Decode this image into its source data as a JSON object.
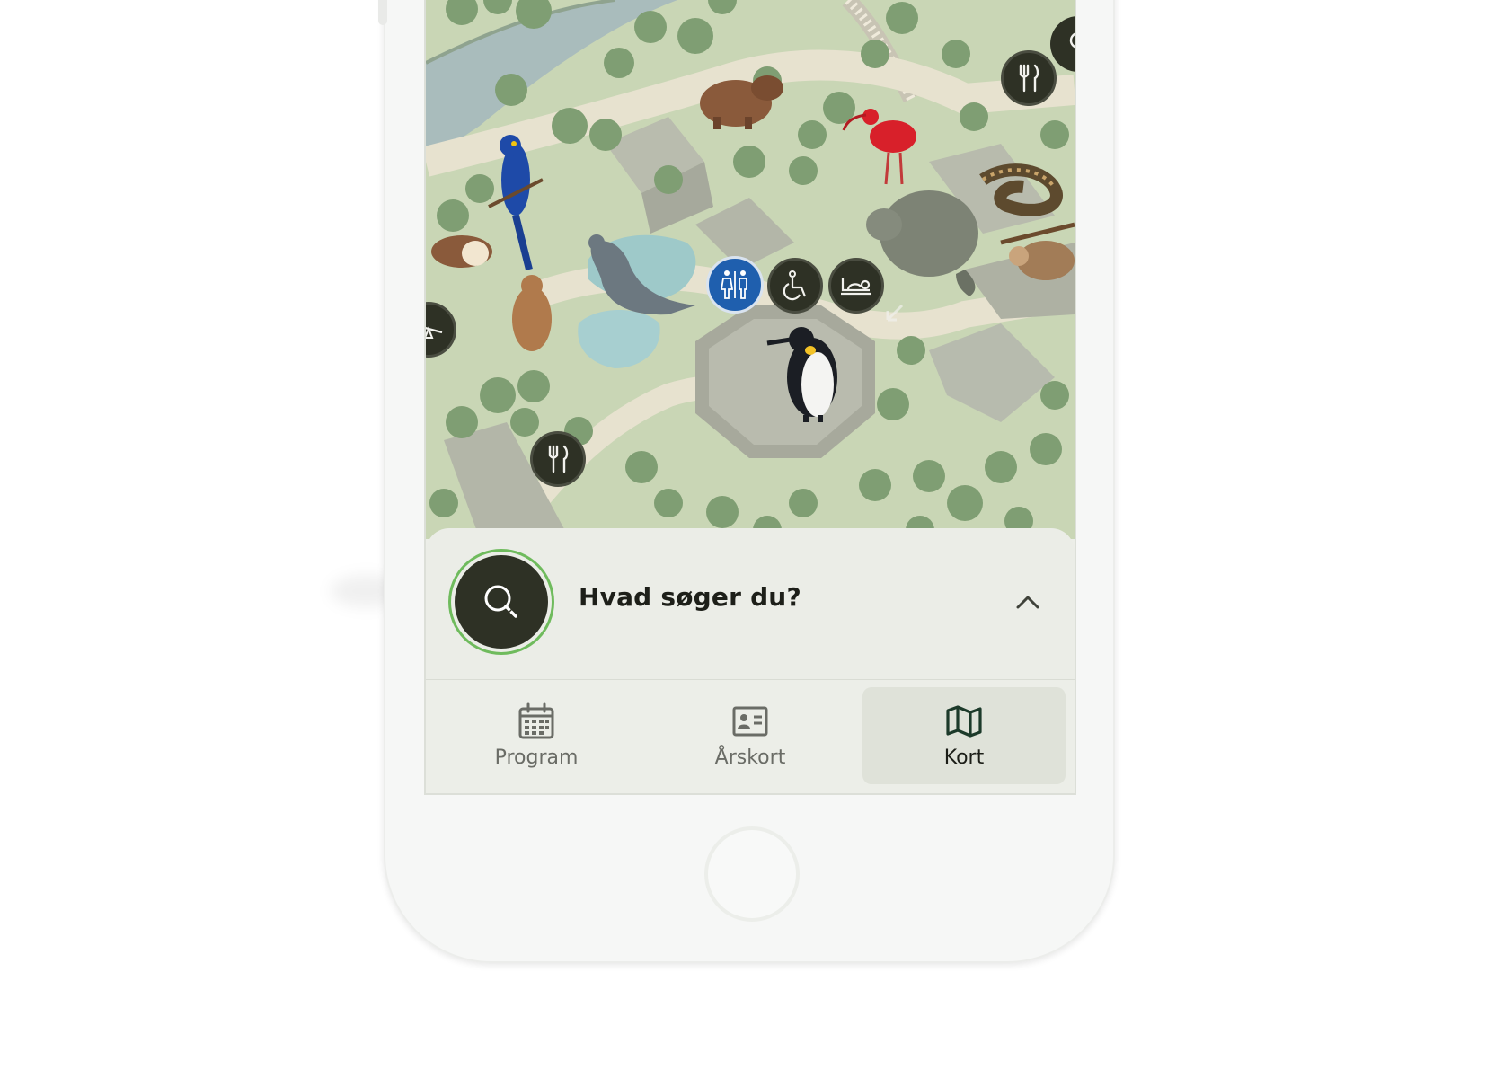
{
  "search": {
    "label": "Hvad søger du?"
  },
  "tabs": [
    {
      "label": "Program",
      "icon": "calendar-icon",
      "active": false
    },
    {
      "label": "Årskort",
      "icon": "id-card-icon",
      "active": false
    },
    {
      "label": "Kort",
      "icon": "map-icon",
      "active": true
    }
  ],
  "map": {
    "markers": [
      "restaurant-icon",
      "toilet-icon",
      "wheelchair-icon",
      "baby-changing-icon",
      "playground-icon"
    ],
    "animals": [
      "capybara",
      "scarlet-ibis",
      "hyacinth-macaw",
      "guinea-pig",
      "prairie-dog",
      "sea-lion",
      "manatee",
      "snake",
      "sloth",
      "king-penguin"
    ]
  },
  "colors": {
    "map_green": "#c9d6b5",
    "tree_green": "#7f9e73",
    "path_beige": "#e7e2cf",
    "marker_dark": "#2e3125",
    "marker_blue": "#1f5fae",
    "search_ring": "#6fbb5d",
    "panel_bg": "#ebede7",
    "active_tab_bg": "#dfe2d9"
  }
}
